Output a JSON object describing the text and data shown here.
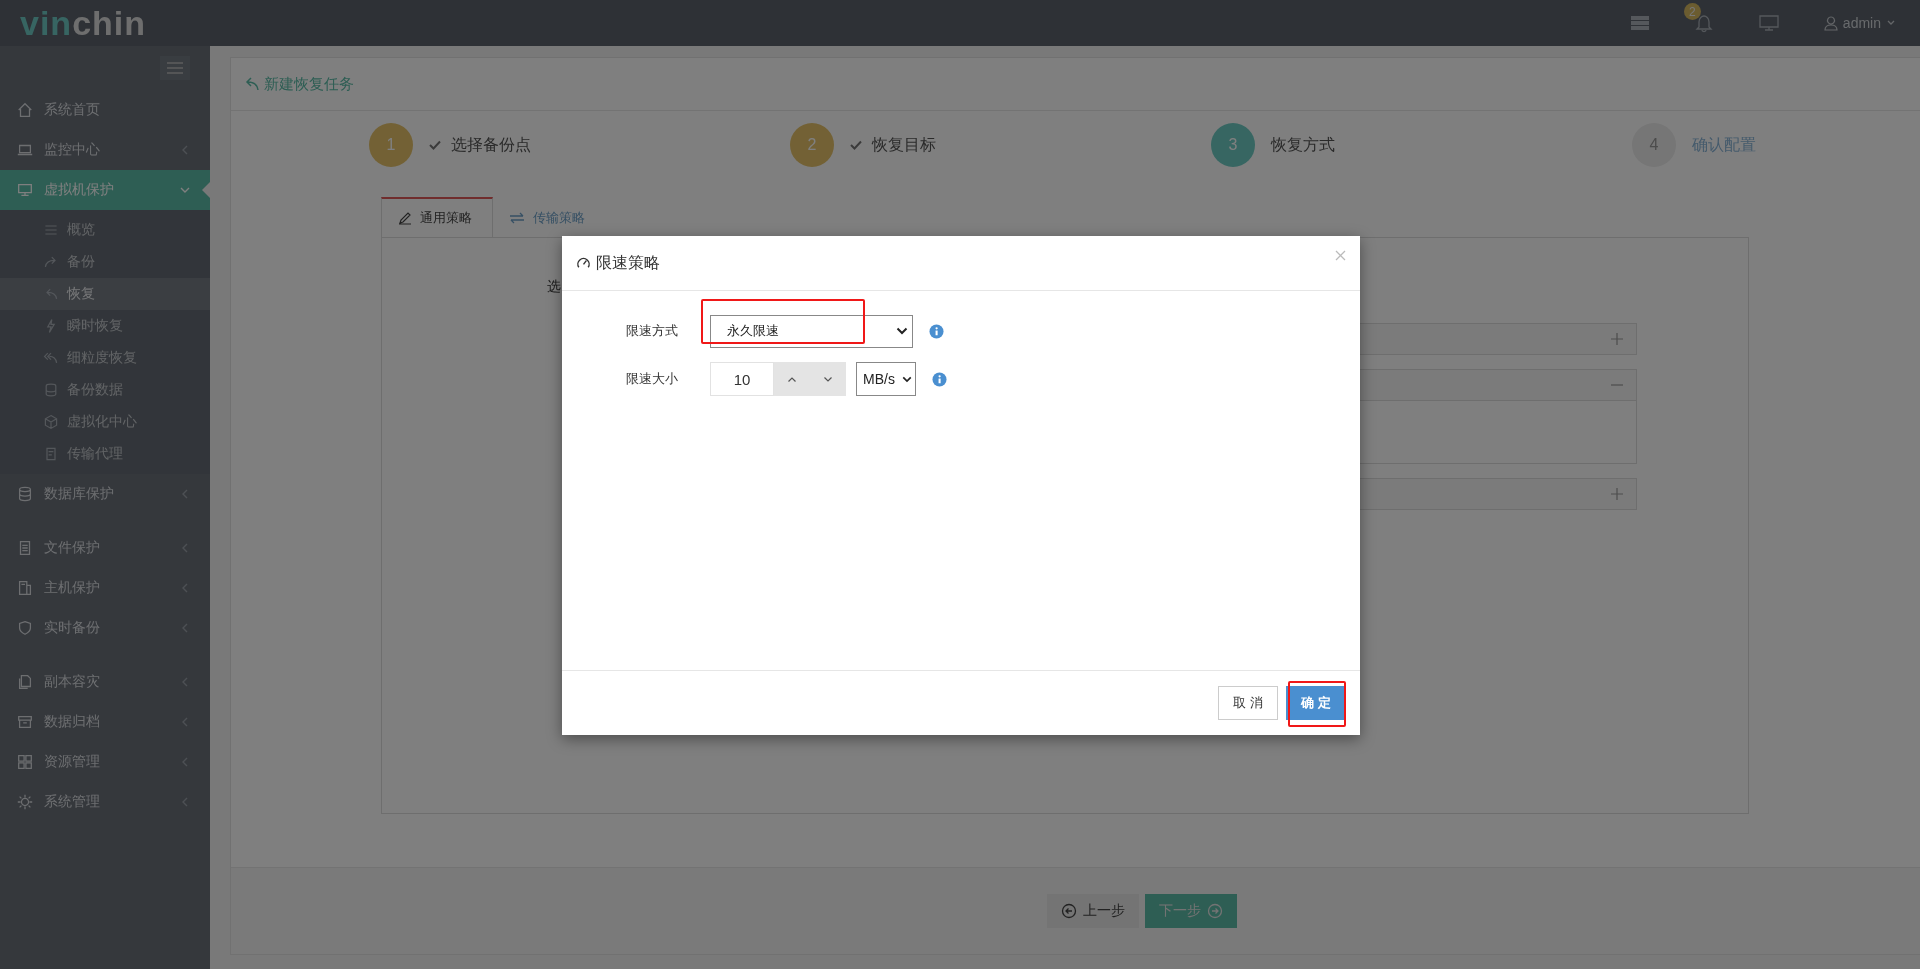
{
  "logo": {
    "part_1": "vin",
    "part_2": "chin"
  },
  "top_bar": {
    "notification_count": "2",
    "user": "admin"
  },
  "sidebar": {
    "items": [
      {
        "label": "系统首页",
        "kind": "link",
        "selected": false
      },
      {
        "label": "监控中心",
        "kind": "group",
        "selected": false,
        "expanded": false
      },
      {
        "label": "虚拟机保护",
        "kind": "group",
        "selected": true,
        "expanded": true,
        "children": [
          {
            "label": "概览",
            "selected": false
          },
          {
            "label": "备份",
            "selected": false
          },
          {
            "label": "恢复",
            "selected": true
          },
          {
            "label": "瞬时恢复",
            "selected": false
          },
          {
            "label": "细粒度恢复",
            "selected": false
          },
          {
            "label": "备份数据",
            "selected": false
          },
          {
            "label": "虚拟化中心",
            "selected": false
          },
          {
            "label": "传输代理",
            "selected": false
          }
        ]
      },
      {
        "label": "数据库保护",
        "kind": "group",
        "selected": false,
        "expanded": false
      },
      {
        "label": "文件保护",
        "kind": "group",
        "selected": false,
        "expanded": false
      },
      {
        "label": "主机保护",
        "kind": "group",
        "selected": false,
        "expanded": false
      },
      {
        "label": "实时备份",
        "kind": "group",
        "selected": false,
        "expanded": false
      },
      {
        "label": "副本容灾",
        "kind": "group",
        "selected": false,
        "expanded": false
      },
      {
        "label": "数据归档",
        "kind": "group",
        "selected": false,
        "expanded": false
      },
      {
        "label": "资源管理",
        "kind": "group",
        "selected": false,
        "expanded": false
      },
      {
        "label": "系统管理",
        "kind": "group",
        "selected": false,
        "expanded": false
      }
    ]
  },
  "page": {
    "title": "新建恢复任务",
    "steps": [
      {
        "number": "1",
        "label": "选择备份点",
        "completed": true,
        "current": false
      },
      {
        "number": "2",
        "label": "恢复目标",
        "completed": true,
        "current": false
      },
      {
        "number": "3",
        "label": "恢复方式",
        "completed": false,
        "current": true
      },
      {
        "number": "4",
        "label": "确认配置",
        "completed": false,
        "current": false
      }
    ],
    "tabs": [
      {
        "label": "通用策略",
        "selected": true
      },
      {
        "label": "传输策略",
        "selected": false
      }
    ],
    "panel": {
      "label_fragment": "选",
      "sections": [
        {
          "expanded": false
        },
        {
          "expanded": true
        },
        {
          "expanded": false
        }
      ]
    },
    "buttons": [
      {
        "label": "上一步",
        "kind": "prev"
      },
      {
        "label": "下一步",
        "kind": "next"
      }
    ]
  },
  "dialog": {
    "title": "限速策略",
    "fields": [
      {
        "label": "限速方式",
        "kind": "select",
        "value": "永久限速",
        "highlighted": true
      },
      {
        "label": "限速大小",
        "kind": "number",
        "value": "10",
        "unit": "MB/s",
        "highlighted": false
      }
    ],
    "buttons": [
      {
        "label": "取 消",
        "kind": "cancel",
        "highlighted": false
      },
      {
        "label": "确 定",
        "kind": "primary",
        "highlighted": true
      }
    ]
  }
}
